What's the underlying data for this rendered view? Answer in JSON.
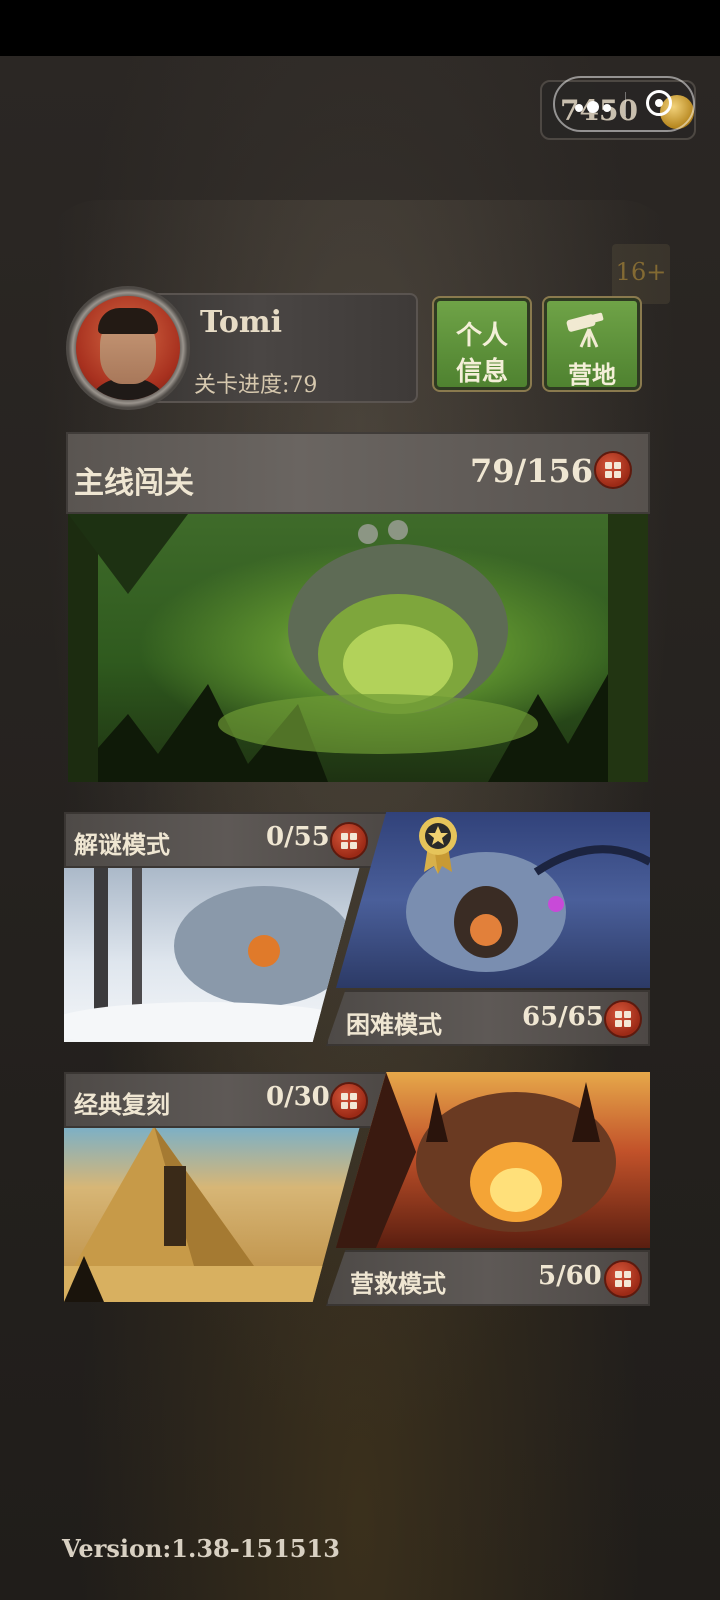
{
  "topbar": {
    "coins": "7450",
    "age_badge": "16+"
  },
  "profile": {
    "name": "Tomi",
    "progress_label": "关卡进度:79"
  },
  "buttons": {
    "info_line1": "个人",
    "info_line2": "信息",
    "camp": "营地"
  },
  "main_mode": {
    "title": "主线闯关",
    "count": "79/156"
  },
  "modes": [
    {
      "title": "解谜模式",
      "count": "0/55"
    },
    {
      "title": "困难模式",
      "count": "65/65"
    },
    {
      "title": "经典复刻",
      "count": "0/30"
    },
    {
      "title": "营救模式",
      "count": "5/60"
    }
  ],
  "version": "Version:1.38-151513",
  "colors": {
    "button_green": "#5f9339",
    "grid_red": "#b73a22"
  },
  "icons": [
    "more-dots-icon",
    "target-close-icon",
    "coin-icon",
    "grid-icon",
    "camp-telescope-icon",
    "medal-star-icon"
  ]
}
